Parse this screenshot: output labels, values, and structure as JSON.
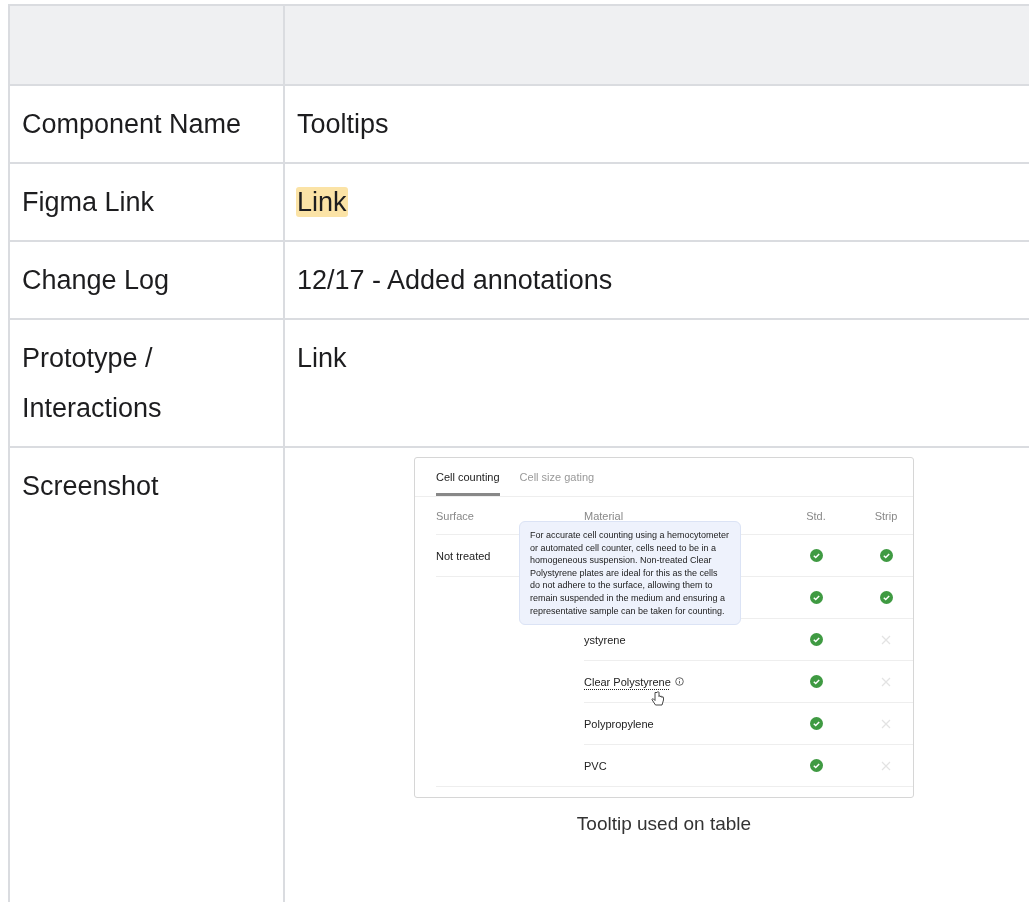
{
  "table": {
    "rows": [
      {
        "label": "Component Name",
        "value": {
          "text": "Tooltips",
          "highlight": false
        }
      },
      {
        "label": "Figma Link",
        "value": {
          "text": "Link",
          "highlight": true
        }
      },
      {
        "label": "Change Log",
        "value": {
          "text": "12/17 - Added annotations",
          "highlight": false
        }
      },
      {
        "label": "Prototype / Interactions",
        "value": {
          "text": "Link",
          "highlight": false
        }
      },
      {
        "label": "Screenshot",
        "screenshot": {
          "tabs": [
            {
              "label": "Cell counting",
              "selected": true
            },
            {
              "label": "Cell size gating",
              "selected": false
            }
          ],
          "columns": [
            "Surface",
            "Material",
            "Std.",
            "Strip"
          ],
          "rows": [
            {
              "surface": "Not treated",
              "std": true,
              "strip": true
            },
            {
              "std": true,
              "strip": true
            },
            {
              "material": "ystyrene",
              "std": true,
              "strip": false
            },
            {
              "material": "Clear Polystyrene",
              "info": true,
              "std": true,
              "strip": false
            },
            {
              "material": "Polypropylene",
              "std": true,
              "strip": false
            },
            {
              "material": "PVC",
              "std": true,
              "strip": false
            }
          ],
          "tooltip": "For accurate cell counting using a hemocytometer or automated cell counter, cells need to be in a homogeneous suspension. Non-treated Clear Polystyrene plates are ideal for this as the cells do not adhere to the surface, allowing them to remain suspended in the medium and ensuring a representative sample can be taken for counting.",
          "caption": "Tooltip used on table"
        }
      }
    ]
  }
}
